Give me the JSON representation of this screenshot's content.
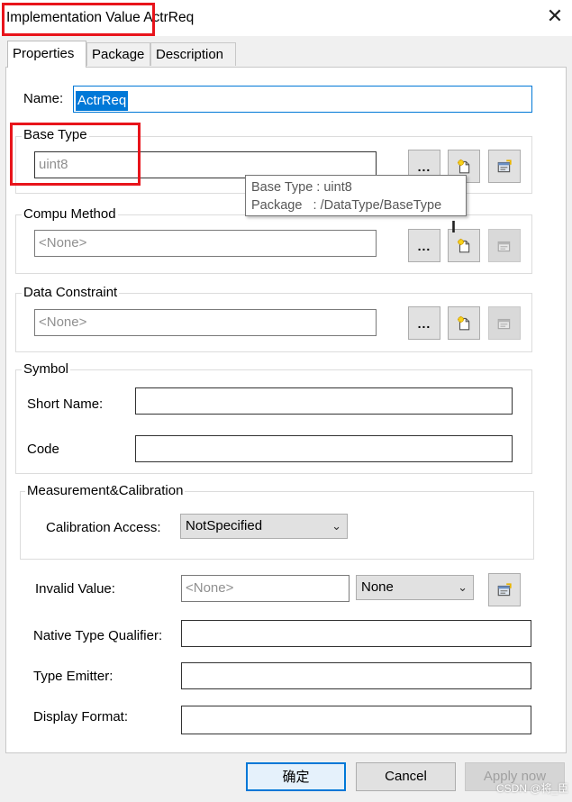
{
  "window": {
    "title": "Implementation Value ActrReq",
    "close_glyph": "✕"
  },
  "tabs": [
    {
      "label": "Properties"
    },
    {
      "label": "Package"
    },
    {
      "label": "Description"
    }
  ],
  "name_field": {
    "label": "Name:",
    "value": "ActrReq"
  },
  "base_type": {
    "legend": "Base Type",
    "value": "uint8"
  },
  "compu_method": {
    "legend": "Compu Method",
    "value": "<None>"
  },
  "data_constraint": {
    "legend": "Data Constraint",
    "value": "<None>"
  },
  "browse_label": "...",
  "tooltip": {
    "line1": "Base Type : uint8",
    "line2": "Package   : /DataType/BaseType"
  },
  "symbol": {
    "legend": "Symbol",
    "short_name_label": "Short Name:",
    "code_label": "Code",
    "short_name_value": "",
    "code_value": ""
  },
  "measurement": {
    "legend": "Measurement&Calibration",
    "calibration_access_label": "Calibration Access:",
    "calibration_access_value": "NotSpecified"
  },
  "invalid_value": {
    "label": "Invalid Value:",
    "value": "<None>",
    "combo_value": "None"
  },
  "native_type_qualifier": {
    "label": "Native Type Qualifier:",
    "value": ""
  },
  "type_emitter": {
    "label": "Type Emitter:",
    "value": ""
  },
  "display_format": {
    "label": "Display Format:",
    "value": ""
  },
  "buttons": {
    "ok": "确定",
    "cancel": "Cancel",
    "apply": "Apply now"
  },
  "watermark": "CSDN @将_臣",
  "colors": {
    "highlight": "#e8141b",
    "selection": "#0078d7"
  },
  "icons": {
    "new": "new-item-icon",
    "edit": "edit-properties-icon",
    "chevron": "chevron-down-icon",
    "close": "close-icon"
  }
}
